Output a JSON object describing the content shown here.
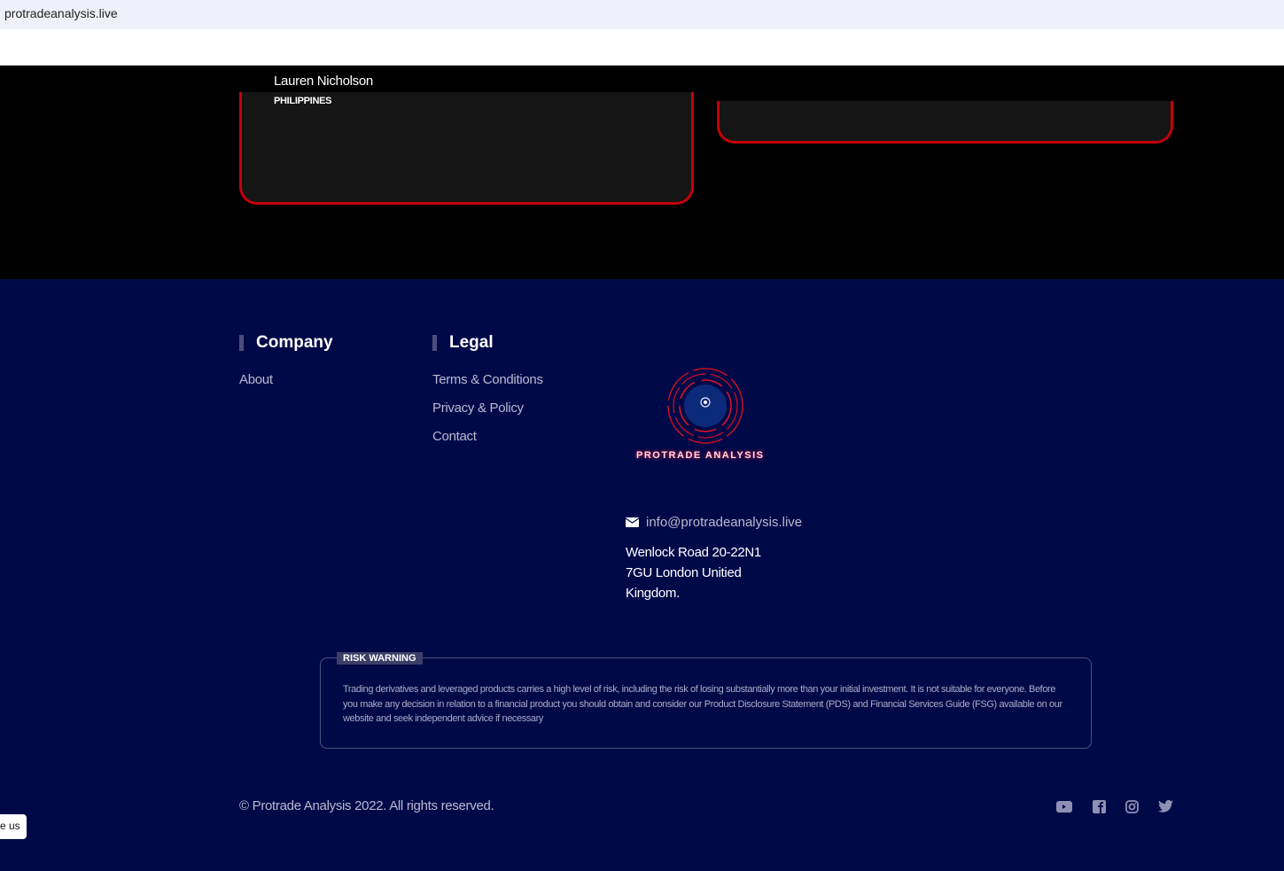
{
  "browser": {
    "url": "protradeanalysis.live"
  },
  "testimonial": {
    "name": "Lauren Nicholson",
    "country": "PHILIPPINES"
  },
  "footer": {
    "company": {
      "title": "Company",
      "links": [
        "About"
      ]
    },
    "legal": {
      "title": "Legal",
      "links": [
        "Terms & Conditions",
        "Privacy & Policy",
        "Contact"
      ]
    },
    "logo_text": "PROTRADE ANALYSIS",
    "email": "info@protradeanalysis.live",
    "address": "Wenlock Road 20-22N1 7GU London Unitied Kingdom.",
    "risk": {
      "label": "RISK WARNING",
      "text": "Trading derivatives and leveraged products carries a high level of risk, including the risk of losing substantially more than your initial investment. It is not suitable for everyone. Before you make any decision in relation to a financial product you should obtain and consider our Product Disclosure Statement (PDS) and Financial Services Guide (FSG) available on our website and seek independent advice if necessary"
    },
    "copyright": "© Protrade Analysis 2022. All rights reserved.",
    "social": [
      "youtube-icon",
      "facebook-icon",
      "instagram-icon",
      "twitter-icon"
    ]
  },
  "chat": {
    "label": "e us"
  }
}
